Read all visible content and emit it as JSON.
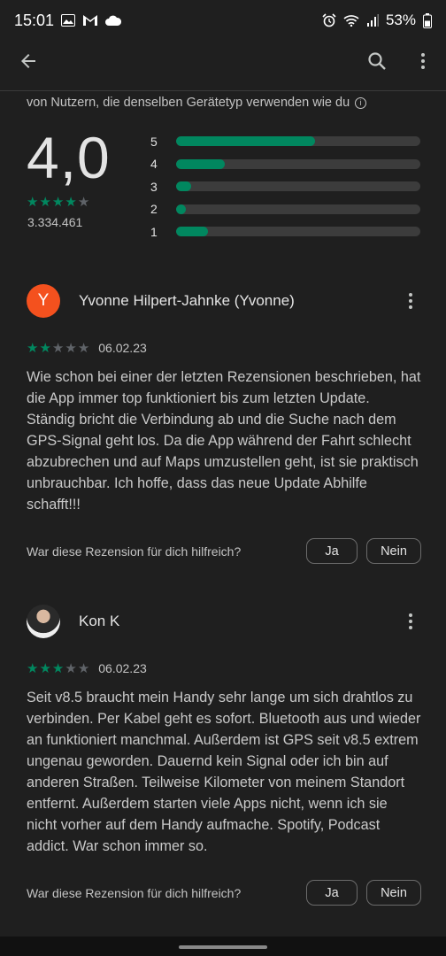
{
  "status": {
    "time": "15:01",
    "battery": "53%",
    "left_icons": [
      "image-icon",
      "gmail-icon",
      "cloud-icon"
    ],
    "right_icons": [
      "alarm-icon",
      "wifi-icon",
      "signal-icon",
      "battery-icon"
    ]
  },
  "app_bar": {
    "icons": [
      "back-arrow-icon",
      "search-icon",
      "more-vert-icon"
    ]
  },
  "ratings": {
    "subtitle": "von Nutzern, die denselben Gerätetyp verwenden wie du",
    "average": "4,0",
    "star_value": 4,
    "count": "3.334.461",
    "distribution": [
      {
        "label": "5",
        "fraction": 0.57
      },
      {
        "label": "4",
        "fraction": 0.2
      },
      {
        "label": "3",
        "fraction": 0.06
      },
      {
        "label": "2",
        "fraction": 0.04
      },
      {
        "label": "1",
        "fraction": 0.13
      }
    ]
  },
  "reviews": [
    {
      "avatar_letter": "Y",
      "name": "Yvonne Hilpert-Jahnke (Yvonne)",
      "stars": 2,
      "date": "06.02.23",
      "text": "Wie schon bei einer der letzten Rezensionen beschrieben, hat die App immer top funktioniert bis zum letzten Update. Ständig bricht die Verbindung ab und die Suche nach dem GPS-Signal geht los. Da die App während der Fahrt schlecht abzubrechen und auf Maps umzustellen geht, ist sie praktisch unbrauchbar. Ich hoffe, dass das neue Update Abhilfe schafft!!!",
      "helpful_question": "War diese Rezension für dich hilfreich?",
      "yes_label": "Ja",
      "no_label": "Nein"
    },
    {
      "avatar_letter": "",
      "name": "Kon K",
      "stars": 3,
      "date": "06.02.23",
      "text": "Seit v8.5 braucht mein Handy sehr lange um sich drahtlos zu verbinden. Per Kabel geht es sofort. Bluetooth aus und wieder an funktioniert manchmal. Außerdem ist GPS seit v8.5 extrem ungenau geworden. Dauernd kein Signal oder ich bin auf anderen Straßen. Teilweise Kilometer von meinem Standort entfernt. Außerdem starten viele Apps nicht, wenn ich sie nicht vorher auf dem Handy aufmache. Spotify, Podcast addict. War schon immer so.",
      "helpful_question": "War diese Rezension für dich hilfreich?",
      "yes_label": "Ja",
      "no_label": "Nein"
    }
  ],
  "colors": {
    "accent": "#01875f",
    "background": "#1f1f1f",
    "avatar_y": "#f4511e"
  }
}
